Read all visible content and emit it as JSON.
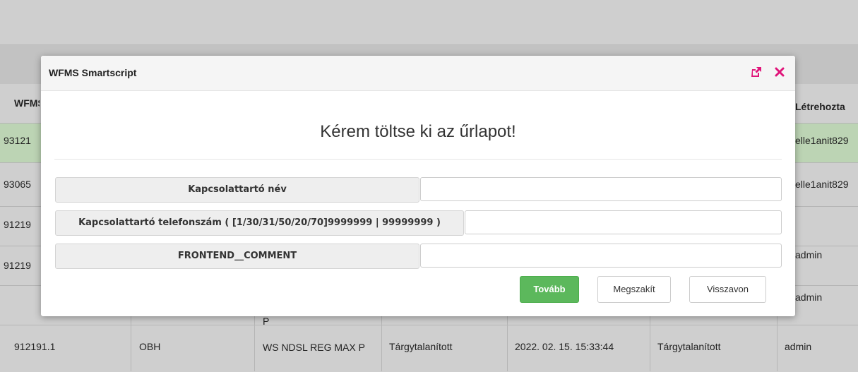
{
  "background": {
    "header_col1": "WFMS azon",
    "header_last": "Létrehozta",
    "rows": [
      {
        "id": "93121",
        "last": "elle1anit829",
        "highlight": true
      },
      {
        "id": "93065",
        "last": "elle1anit829",
        "highlight": false
      },
      {
        "id": "91219",
        "last": "admin",
        "highlight": false
      },
      {
        "id": "91219",
        "last": "admin",
        "highlight": false
      }
    ],
    "bottom_row": {
      "id": "912191.1",
      "c2": "OBH",
      "c3": "WS NDSL REG MAX P",
      "c4": "Tárgytalanított",
      "c5": "2022. 02. 15. 15:33:44",
      "c6": "Tárgytalanított",
      "c7": "admin"
    },
    "row4_partial": "P"
  },
  "modal": {
    "title": "WFMS Smartscript",
    "heading": "Kérem töltse ki az űrlapot!",
    "fields": [
      {
        "label": "Kapcsolattartó név",
        "value": ""
      },
      {
        "label": "Kapcsolattartó telefonszám ( [1/30/31/50/20/70]9999999 | 99999999 )",
        "value": ""
      },
      {
        "label": "FRONTEND__COMMENT",
        "value": ""
      }
    ],
    "buttons": {
      "next": "Tovább",
      "abort": "Megszakít",
      "revoke": "Visszavon"
    },
    "icons": {
      "popout": "external-link-icon",
      "close": "close-icon"
    },
    "accent_color": "#e0157a"
  },
  "colors": {
    "highlight_row": "#bcd4b4",
    "primary_button": "#5cb85c"
  }
}
